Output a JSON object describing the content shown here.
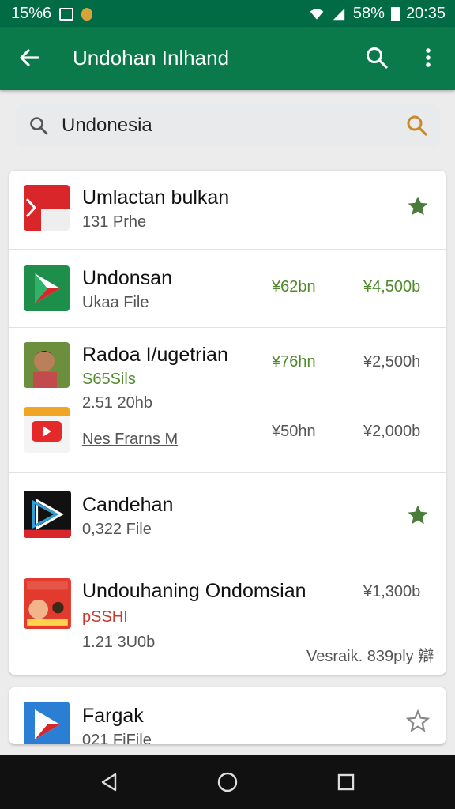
{
  "status_bar": {
    "time_left": "15%6",
    "battery": "58%",
    "time": "20:35"
  },
  "app_bar": {
    "title": "Undohan Inlhand",
    "icons": [
      "back-arrow-icon",
      "search-icon",
      "more-vert-icon"
    ]
  },
  "search": {
    "value": "Undonesia",
    "icons": [
      "search-icon",
      "search-icon-accent"
    ]
  },
  "results": [
    {
      "name": "Umlactan bulkan",
      "sub": "131 Prhe",
      "starred": true,
      "icon": "red-flag-app-icon"
    },
    {
      "name": "Undonsan",
      "sub": "Ukaa File",
      "price_green": "¥62bn",
      "price": "¥4,500b",
      "icon": "play-store-icon"
    },
    {
      "name": "Radoa I/ugetrian",
      "sub_green": "S65Sils",
      "sub": "2.51 20hb",
      "price_green": "¥76hn",
      "price": "¥2,500h",
      "icon": "person-photo-icon",
      "extra": {
        "link": "Nes Frarns M",
        "price_a": "¥50hn",
        "price_b": "¥2,000b",
        "icon": "youtube-calendar-icon"
      }
    },
    {
      "name": "Candehan",
      "sub": "0,322 File",
      "starred": true,
      "icon": "black-play-icon"
    },
    {
      "name": "Undouhaning Ondomsian",
      "sub_red": "pSSHI",
      "sub": "1.21 3U0b",
      "price": "¥1,300b",
      "footer": "Vesraik. 839ply 辯",
      "icon": "movie-poster-icon"
    }
  ],
  "partial_card": {
    "name": "Fargak",
    "sub": "021 FiFile",
    "starred": false,
    "icon": "blue-play-icon"
  },
  "nav_bar": {
    "icons": [
      "back-triangle-icon",
      "home-circle-icon",
      "recents-square-icon"
    ]
  },
  "colors": {
    "primary": "#0b7a4b",
    "primary_dark": "#006b45",
    "accent_green": "#4f8a2b",
    "star": "#4b7d3a"
  }
}
